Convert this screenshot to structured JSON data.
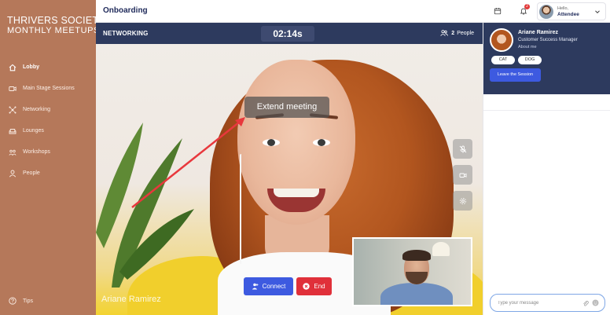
{
  "sidebar": {
    "brand_line1": "THRIVERS SOCIETY",
    "brand_line2": "MONTHLY MEETUPS",
    "items": [
      {
        "label": "Lobby",
        "icon": "home-icon",
        "active": true
      },
      {
        "label": "Main Stage Sessions",
        "icon": "video-camera-icon",
        "active": false
      },
      {
        "label": "Networking",
        "icon": "network-icon",
        "active": false
      },
      {
        "label": "Lounges",
        "icon": "couch-icon",
        "active": false
      },
      {
        "label": "Workshops",
        "icon": "workshop-icon",
        "active": false
      },
      {
        "label": "People",
        "icon": "person-icon",
        "active": false
      }
    ],
    "tips_label": "Tips"
  },
  "header": {
    "title": "Onboarding",
    "notification_count": "2",
    "user_greeting": "Hello,",
    "user_name": "Attendee"
  },
  "video": {
    "section_label": "NETWORKING",
    "timer": "02:14s",
    "people_count": "2",
    "people_label": "People",
    "tooltip": "Extend meeting",
    "participant_name": "Ariane Ramirez",
    "connect_label": "Connect",
    "end_label": "End"
  },
  "profile": {
    "name": "Ariane Ramirez",
    "role": "Customer Success Manager",
    "about_label": "About me",
    "tags": [
      "CAT",
      "DOG"
    ],
    "leave_label": "Leave the Session"
  },
  "chat": {
    "placeholder": "Type your message"
  },
  "colors": {
    "sidebar": "#b5785a",
    "navy": "#2d3a5e",
    "primary": "#3d5ae0",
    "danger": "#e0303a"
  }
}
